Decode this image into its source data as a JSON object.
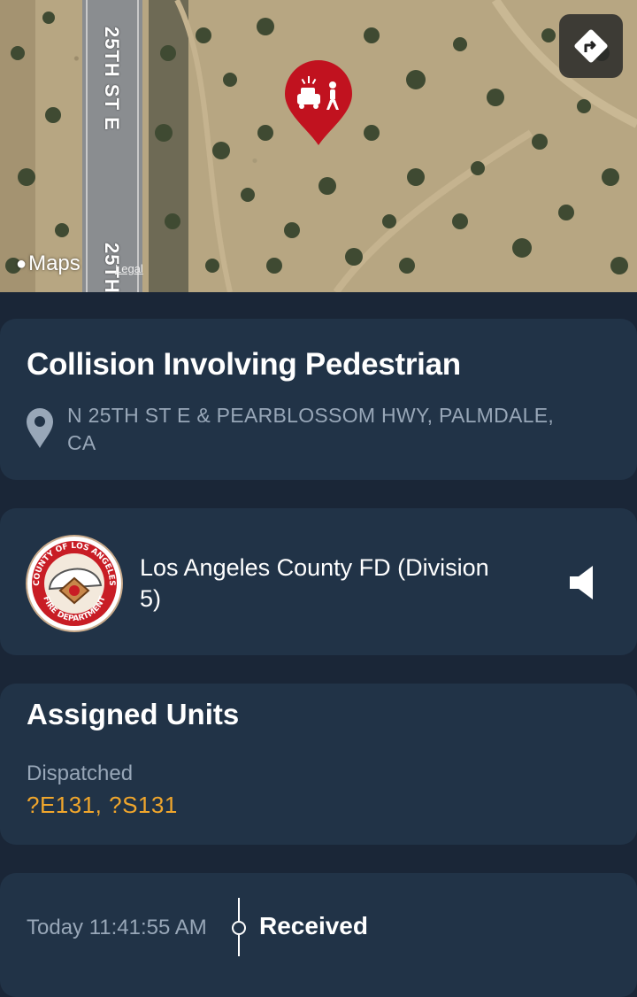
{
  "map": {
    "street_label_top": "25TH ST E",
    "street_label_bottom": "25TH",
    "logo_text": "Maps",
    "legal_text": "Legal",
    "pin_icon": "car-pedestrian-collision-icon",
    "directions_icon": "directions-icon",
    "pin_color": "#c1121f"
  },
  "incident": {
    "title": "Collision Involving Pedestrian",
    "address": "N 25TH ST E & PEARBLOSSOM HWY, PALMDALE, CA",
    "location_icon": "location-pin-icon"
  },
  "agency": {
    "name": "Los Angeles County FD (Division 5)",
    "seal_text_top": "COUNTY OF LOS ANGELES",
    "seal_text_bottom": "FIRE DEPARTMENT",
    "audio_icon": "speaker-icon"
  },
  "units": {
    "heading": "Assigned Units",
    "status": "Dispatched",
    "list": "?E131, ?S131",
    "list_color": "#f0a62c"
  },
  "timeline": {
    "time": "Today 11:41:55 AM",
    "event": "Received"
  },
  "colors": {
    "background": "#1a2637",
    "card": "#213347",
    "muted_text": "#98a7b8"
  }
}
